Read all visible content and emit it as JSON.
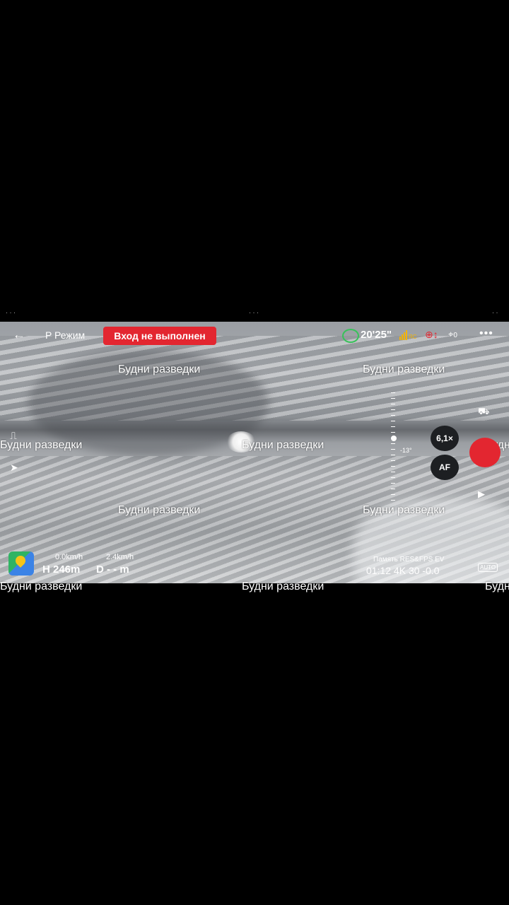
{
  "header": {
    "back_glyph": "←",
    "mode_label": "P Режим",
    "login_status": "Вход не выполнен",
    "flight_time": "20'25\"",
    "signal_label": "RC",
    "satellites": "0",
    "more_glyph": "•••"
  },
  "watermark": "Будни разведки",
  "camera": {
    "zoom_label": "6,1×",
    "af_label": "AF",
    "gimbal_angle": "-13°"
  },
  "telemetry": {
    "horizontal_speed": "0.0km/h",
    "vertical_speed": "2.4km/h",
    "height": "H 246m",
    "distance": "D - - m"
  },
  "recording": {
    "labels": "Память  RES&FPS  EV",
    "values": "01:12  4K 30  -0.0",
    "auto_label": "AUTO"
  },
  "colors": {
    "accent_red": "#e32630",
    "battery_green": "#38c25a"
  },
  "icons": [
    "back-arrow-icon",
    "battery-ring-icon",
    "signal-bars-icon",
    "gps-icon",
    "satellite-icon",
    "more-icon",
    "map-icon",
    "record-button",
    "playback-icon",
    "camera-settings-icon"
  ]
}
